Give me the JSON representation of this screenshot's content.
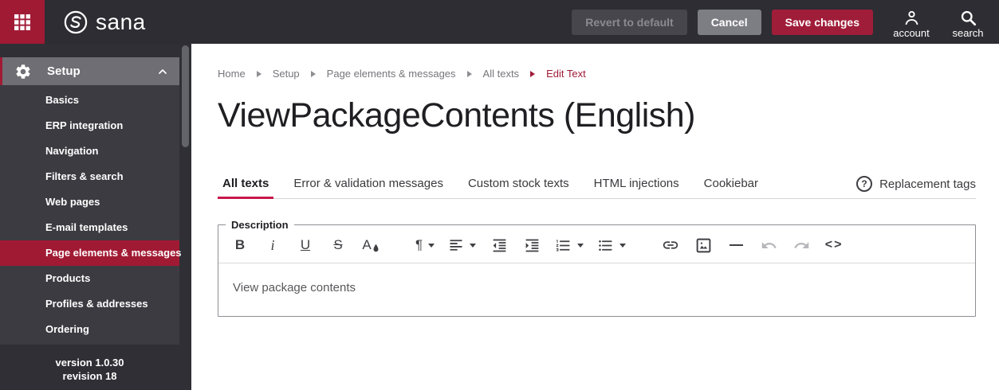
{
  "topbar": {
    "brand": "sana",
    "revert_label": "Revert to default",
    "cancel_label": "Cancel",
    "save_label": "Save changes",
    "account_label": "account",
    "search_label": "search"
  },
  "sidebar": {
    "section_label": "Setup",
    "items": [
      {
        "label": "Basics",
        "active": false
      },
      {
        "label": "ERP integration",
        "active": false
      },
      {
        "label": "Navigation",
        "active": false
      },
      {
        "label": "Filters & search",
        "active": false
      },
      {
        "label": "Web pages",
        "active": false
      },
      {
        "label": "E-mail templates",
        "active": false
      },
      {
        "label": "Page elements & messages",
        "active": true
      },
      {
        "label": "Products",
        "active": false
      },
      {
        "label": "Profiles & addresses",
        "active": false
      },
      {
        "label": "Ordering",
        "active": false
      }
    ],
    "version_line1": "version 1.0.30",
    "version_line2": "revision 18"
  },
  "breadcrumb": {
    "items": [
      {
        "label": "Home"
      },
      {
        "label": "Setup"
      },
      {
        "label": "Page elements & messages"
      },
      {
        "label": "All texts"
      }
    ],
    "current": "Edit Text"
  },
  "page": {
    "title": "ViewPackageContents (English)"
  },
  "tabs": {
    "items": [
      {
        "label": "All texts",
        "active": true
      },
      {
        "label": "Error & validation messages",
        "active": false
      },
      {
        "label": "Custom stock texts",
        "active": false
      },
      {
        "label": "HTML injections",
        "active": false
      },
      {
        "label": "Cookiebar",
        "active": false
      }
    ],
    "help_icon": "?",
    "help_label": "Replacement tags"
  },
  "editor": {
    "legend": "Description",
    "content": "View package contents",
    "toolbar_glyphs": {
      "bold": "B",
      "italic": "i",
      "underline": "U",
      "strikethrough": "S",
      "font_color": "A",
      "paragraph": "¶",
      "code": "<>"
    },
    "toolbar_icon_names": [
      "bold",
      "italic",
      "underline",
      "strikethrough",
      "font-color",
      "paragraph-format",
      "align",
      "outdent",
      "indent",
      "ordered-list",
      "unordered-list",
      "insert-link",
      "insert-image",
      "horizontal-line",
      "undo",
      "redo",
      "code-view"
    ]
  },
  "colors": {
    "accent": "#a11a34",
    "tab_underline": "#c7184a",
    "topbar_bg": "#2d2d33",
    "sidebar_bg": "#2f2f35",
    "nav_bg": "#3b3b41",
    "section_header_bg": "#6e6e74",
    "save_button_bg": "#a01d39",
    "cancel_button_bg": "#7d7d84",
    "disabled_text": "#8a8a90"
  }
}
